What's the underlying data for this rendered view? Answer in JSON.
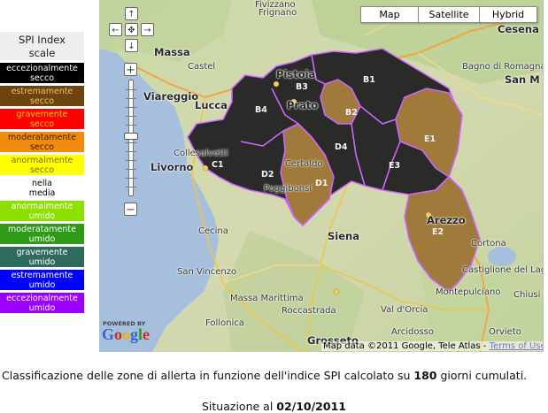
{
  "legend": {
    "title_line1": "SPI Index",
    "title_line2": "scale",
    "items": [
      {
        "line1": "eccezionalmente",
        "line2": "secco",
        "bg": "#000000",
        "fg": "#ffffff"
      },
      {
        "line1": "estremamente",
        "line2": "secco",
        "bg": "#6b4410",
        "fg": "#f0c060"
      },
      {
        "line1": "gravemente",
        "line2": "secco",
        "bg": "#ff0000",
        "fg": "#ffd200"
      },
      {
        "line1": "moderatamente",
        "line2": "secco",
        "bg": "#f08c0a",
        "fg": "#3a1a00"
      },
      {
        "line1": "anormalmente",
        "line2": "secco",
        "bg": "#ffff00",
        "fg": "#7a6a00"
      },
      {
        "line1": "nella",
        "line2": "media",
        "bg": "#ffffff",
        "fg": "#000000"
      },
      {
        "line1": "anormalmente",
        "line2": "umido",
        "bg": "#8ee000",
        "fg": "#ffffff"
      },
      {
        "line1": "moderatamente",
        "line2": "umido",
        "bg": "#2f9a17",
        "fg": "#ffffff"
      },
      {
        "line1": "gravemente",
        "line2": "umido",
        "bg": "#2e6b5e",
        "fg": "#ffffff"
      },
      {
        "line1": "estremamente",
        "line2": "umido",
        "bg": "#0000ff",
        "fg": "#ffffff"
      },
      {
        "line1": "eccezionalmente",
        "line2": "umido",
        "bg": "#9b00ff",
        "fg": "#ffffff"
      }
    ]
  },
  "map": {
    "map_types": [
      "Map",
      "Satellite",
      "Hybrid"
    ],
    "nav": {
      "up": "↑",
      "left": "←",
      "center": "✥",
      "right": "→",
      "down": "↓",
      "zoom_in": "+",
      "zoom_out": "−"
    },
    "powered_by": "POWERED BY",
    "logo": "Google",
    "attribution": "Map data ©2011 Google, Tele Atlas - ",
    "terms": "Terms of Use",
    "zone_colors": {
      "dry_extreme": "#a07a3a",
      "dry_exceptional": "#2a2a28",
      "border": "#cc66ff"
    },
    "zones": [
      "B3",
      "B1",
      "B2",
      "B4",
      "E1",
      "C1",
      "D2",
      "D1",
      "D4",
      "E3",
      "E2"
    ],
    "places": [
      "Fivizzano",
      "Frignano",
      "Cesena",
      "Massa",
      "Castel",
      "Bagno di Romagna",
      "Viareggio",
      "Lucca",
      "Pistoia",
      "Prato",
      "San M",
      "Livorno",
      "Collesalvetti",
      "Cecina",
      "Certaldo",
      "Poggibonsi",
      "Arezzo",
      "Cortona",
      "Castiglione del Lago",
      "Montepulciano",
      "Siena",
      "San Vincenzo",
      "Follonica",
      "Grosseto",
      "Arcidosso",
      "Massa Marittima",
      "Roccastrada",
      "Val d'Orcia",
      "Orvieto",
      "Chiusi"
    ]
  },
  "caption": {
    "prefix": "Classificazione delle zone di allerta in funzione dell'indice SPI calcolato su ",
    "days": "180",
    "suffix": " giorni cumulati.",
    "situation_prefix": "Situazione al ",
    "date": "02/10/2011"
  }
}
